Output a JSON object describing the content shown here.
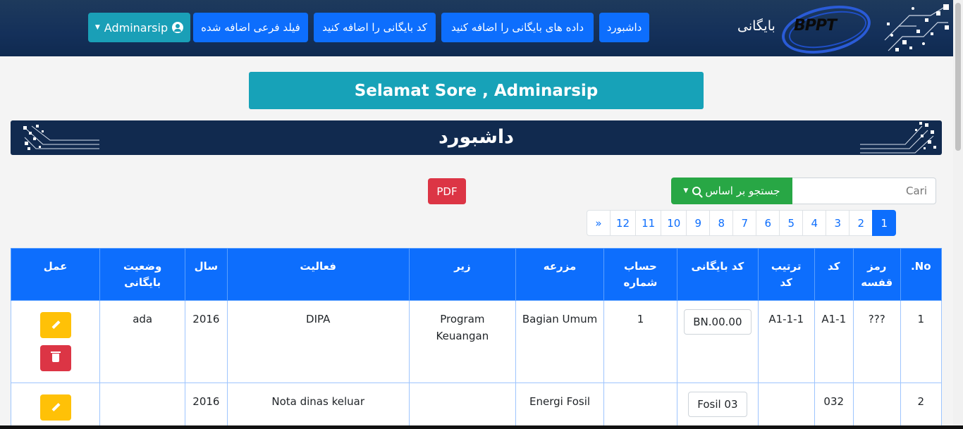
{
  "navbar": {
    "brand_logo_text": "BPPT",
    "brand_name": "بایگانی",
    "items": [
      {
        "label": "داشبورد"
      },
      {
        "label": "داده های بایگانی را اضافه کنید"
      },
      {
        "label": "کد بایگانی را اضافه کنید"
      },
      {
        "label": "فیلد فرعی اضافه شده"
      }
    ],
    "user_label": "Adminarsip"
  },
  "greeting": "Selamat Sore , Adminarsip",
  "banner_title": "داشبورد",
  "search": {
    "placeholder": "Cari",
    "button_label": "جستجو بر اساس"
  },
  "pdf_label": "PDF",
  "pagination": {
    "active_page": "1",
    "pages": [
      "»",
      "12",
      "11",
      "10",
      "9",
      "8",
      "7",
      "6",
      "5",
      "4",
      "3",
      "2",
      "1"
    ]
  },
  "table": {
    "headers": [
      "No.",
      "رمز قفسه",
      "کد",
      "ترتیب کد",
      "کد بایگانی",
      "حساب شماره",
      "مزرعه",
      "زیر",
      "فعالیت",
      "سال",
      "وضعیت بایگانی",
      "عمل"
    ],
    "rows": [
      {
        "no": "1",
        "shelf": "???",
        "code": "A1-1",
        "code_order": "A1-1-1",
        "archive_code": "BN.00.00",
        "account": "1",
        "field": "Bagian Umum",
        "sub": "Program Keuangan",
        "activity": "DIPA",
        "year": "2016",
        "status": "ada"
      },
      {
        "no": "2",
        "shelf": "",
        "code": "032",
        "code_order": "",
        "archive_code": "Fosil 03",
        "account": "",
        "field": "Energi Fosil",
        "sub": "",
        "activity": "Nota dinas keluar",
        "year": "2016",
        "status": ""
      }
    ]
  },
  "colors": {
    "primary": "#0d6efd",
    "info": "#17a2b8",
    "success": "#28a745",
    "danger": "#dc3545",
    "warning": "#ffc107",
    "navbar": "#14305a"
  },
  "icons": {
    "user": "user-circle-icon",
    "search": "search-icon",
    "edit": "pencil-icon",
    "delete": "trash-icon"
  }
}
